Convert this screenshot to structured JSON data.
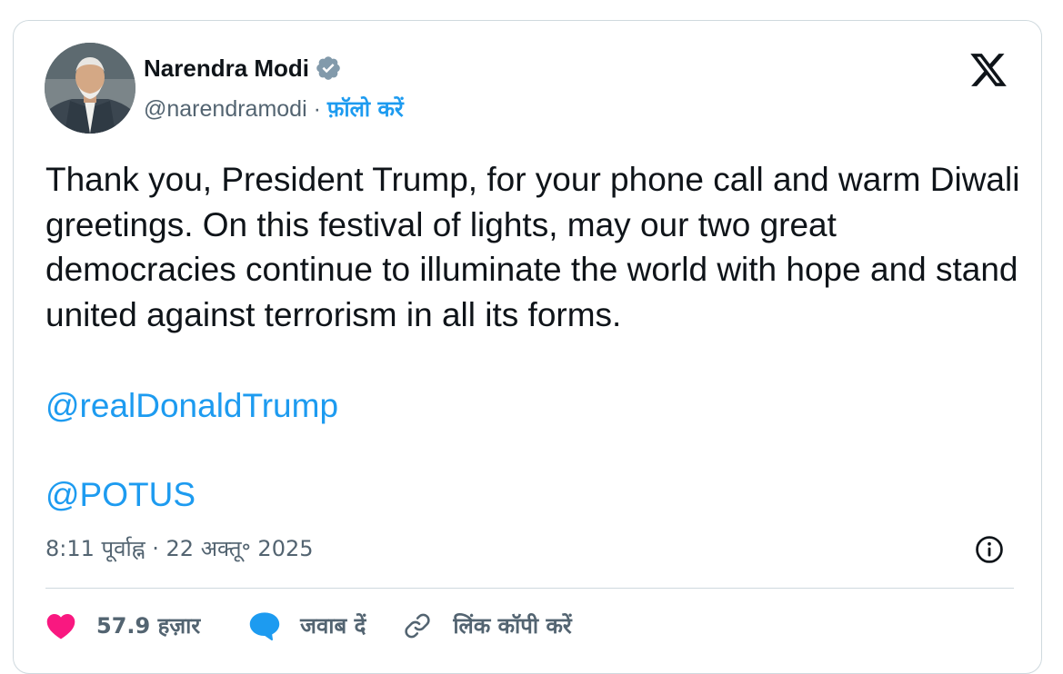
{
  "author": {
    "name": "Narendra Modi",
    "handle": "@narendramodi",
    "separator": "·",
    "follow_label": "फ़ॉलो करें",
    "verified_icon": "verified-badge-icon",
    "avatar_icon": "profile-photo"
  },
  "brand": {
    "logo_icon": "x-logo-icon"
  },
  "tweet": {
    "text": "Thank you, President Trump, for your phone call and warm Diwali greetings. On this festival of lights, may our two great democracies continue to illuminate the world with hope and stand united against terrorism in all its forms.",
    "mentions": [
      "@realDonaldTrump",
      "@POTUS"
    ],
    "timestamp": "8:11 पूर्वाह्न · 22 अक्तू॰ 2025"
  },
  "info": {
    "icon": "info-icon"
  },
  "actions": {
    "like_count": "57.9 हज़ार",
    "reply_label": "जवाब दें",
    "copy_link_label": "लिंक कॉपी करें",
    "like_icon": "heart-icon",
    "reply_icon": "speech-bubble-icon",
    "link_icon": "link-icon"
  },
  "colors": {
    "accent": "#1d9bf0",
    "text_primary": "#0f1419",
    "text_secondary": "#536471",
    "like": "#f91880",
    "border": "#cfd9de"
  }
}
